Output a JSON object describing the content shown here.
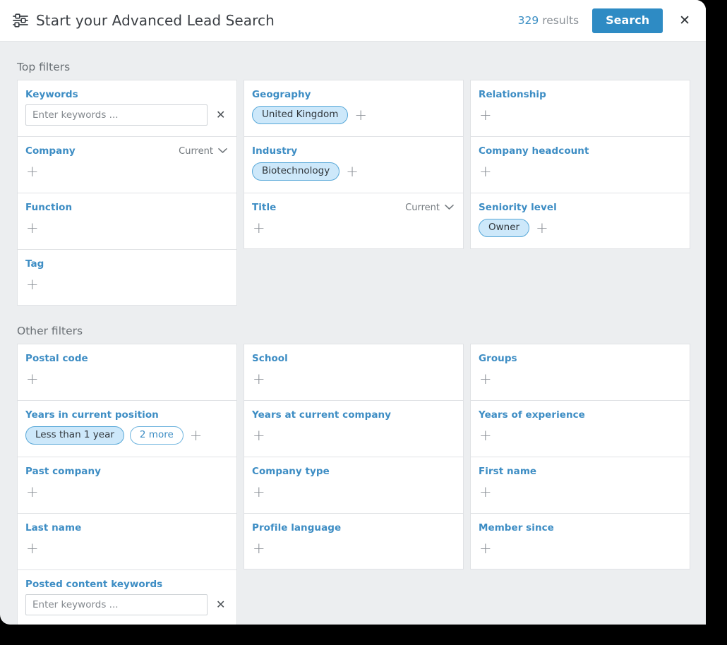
{
  "header": {
    "icon": "sliders-icon",
    "title": "Start your Advanced Lead Search",
    "results_count": "329",
    "results_label": "results",
    "search_label": "Search",
    "close_label": "✕"
  },
  "sections": {
    "top_title": "Top filters",
    "other_title": "Other filters"
  },
  "colors": {
    "accent": "#3d8dc4",
    "button": "#2e8bc4",
    "pill_fill": "#cde8fa",
    "pill_border": "#58a8d8",
    "page_bg": "#eceef0"
  },
  "plus_glyph": "+",
  "top_filters": {
    "col1": [
      {
        "label": "Keywords",
        "type": "input",
        "value": "",
        "placeholder": "Enter keywords ...",
        "clear": "✕"
      },
      {
        "label": "Company",
        "type": "scope",
        "scope": "Current",
        "pills": []
      },
      {
        "label": "Function",
        "type": "plain",
        "pills": []
      },
      {
        "label": "Tag",
        "type": "plain",
        "pills": []
      }
    ],
    "col2": [
      {
        "label": "Geography",
        "type": "plain",
        "pills": [
          {
            "text": "United Kingdom",
            "style": "filled"
          }
        ]
      },
      {
        "label": "Industry",
        "type": "plain",
        "pills": [
          {
            "text": "Biotechnology",
            "style": "filled"
          }
        ]
      },
      {
        "label": "Title",
        "type": "scope",
        "scope": "Current",
        "pills": []
      }
    ],
    "col3": [
      {
        "label": "Relationship",
        "type": "plain",
        "pills": []
      },
      {
        "label": "Company headcount",
        "type": "plain",
        "pills": []
      },
      {
        "label": "Seniority level",
        "type": "plain",
        "pills": [
          {
            "text": "Owner",
            "style": "filled"
          }
        ]
      }
    ]
  },
  "other_filters": {
    "col1": [
      {
        "label": "Postal code",
        "type": "plain",
        "pills": []
      },
      {
        "label": "Years in current position",
        "type": "plain",
        "pills": [
          {
            "text": "Less than 1 year",
            "style": "filled"
          },
          {
            "text": "2 more",
            "style": "outline"
          }
        ]
      },
      {
        "label": "Past company",
        "type": "plain",
        "pills": []
      },
      {
        "label": "Last name",
        "type": "plain",
        "pills": []
      },
      {
        "label": "Posted content keywords",
        "type": "input",
        "value": "",
        "placeholder": "Enter keywords ...",
        "clear": "✕"
      }
    ],
    "col2": [
      {
        "label": "School",
        "type": "plain",
        "pills": []
      },
      {
        "label": "Years at current company",
        "type": "plain",
        "pills": []
      },
      {
        "label": "Company type",
        "type": "plain",
        "pills": []
      },
      {
        "label": "Profile language",
        "type": "plain",
        "pills": []
      }
    ],
    "col3": [
      {
        "label": "Groups",
        "type": "plain",
        "pills": []
      },
      {
        "label": "Years of experience",
        "type": "plain",
        "pills": []
      },
      {
        "label": "First name",
        "type": "plain",
        "pills": []
      },
      {
        "label": "Member since",
        "type": "plain",
        "pills": []
      }
    ]
  }
}
